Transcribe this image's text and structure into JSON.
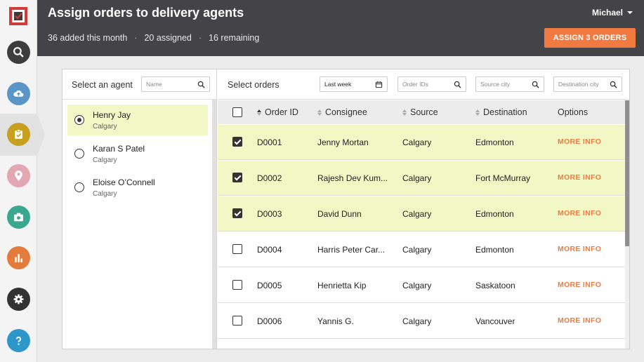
{
  "header": {
    "title": "Assign orders to delivery agents",
    "stats": [
      "36 added this month",
      "20 assigned",
      "16 remaining"
    ],
    "separator": "·",
    "user": "Michael",
    "assign_button": "ASSIGN 3 ORDERS"
  },
  "sidebar": {
    "items": [
      {
        "icon": "search-icon",
        "color": "#3d3d3d"
      },
      {
        "icon": "cloud-upload-icon",
        "color": "#5b95c8"
      },
      {
        "icon": "clipboard-check-icon",
        "color": "#c6a01e"
      },
      {
        "icon": "location-pin-icon",
        "color": "#e3a6b3"
      },
      {
        "icon": "camera-icon",
        "color": "#3aa88f"
      },
      {
        "icon": "bar-chart-icon",
        "color": "#e37b3d"
      },
      {
        "icon": "gear-icon",
        "color": "#333333"
      },
      {
        "icon": "help-icon",
        "color": "#2e97c9"
      }
    ]
  },
  "agents": {
    "title": "Select an agent",
    "search_placeholder": "Name",
    "list": [
      {
        "name": "Henry Jay",
        "city": "Calgary",
        "selected": true
      },
      {
        "name": "Karan S Patel",
        "city": "Calgary",
        "selected": false
      },
      {
        "name": "Eloise O’Connell",
        "city": "Calgary",
        "selected": false
      }
    ]
  },
  "orders": {
    "title": "Select orders",
    "date_filter": "Last week",
    "order_ids_placeholder": "Order IDs",
    "source_placeholder": "Source city",
    "destination_placeholder": "Destination city",
    "columns": {
      "order_id": "Order ID",
      "consignee": "Consignee",
      "source": "Source",
      "destination": "Destination",
      "options": "Options"
    },
    "more_info_label": "MORE INFO",
    "rows": [
      {
        "id": "D0001",
        "consignee": "Jenny Mortan",
        "source": "Calgary",
        "destination": "Edmonton",
        "checked": true
      },
      {
        "id": "D0002",
        "consignee": "Rajesh Dev Kum...",
        "source": "Calgary",
        "destination": "Fort McMurray",
        "checked": true
      },
      {
        "id": "D0003",
        "consignee": "David Dunn",
        "source": "Calgary",
        "destination": "Edmonton",
        "checked": true
      },
      {
        "id": "D0004",
        "consignee": "Harris Peter Car...",
        "source": "Calgary",
        "destination": "Edmonton",
        "checked": false
      },
      {
        "id": "D0005",
        "consignee": "Henrietta Kip",
        "source": "Calgary",
        "destination": "Saskatoon",
        "checked": false
      },
      {
        "id": "D0006",
        "consignee": "Yannis G.",
        "source": "Calgary",
        "destination": "Vancouver",
        "checked": false
      }
    ]
  },
  "colors": {
    "header_bg": "#444347",
    "accent": "#f07a3f",
    "selected_row": "#f2f7c6"
  }
}
